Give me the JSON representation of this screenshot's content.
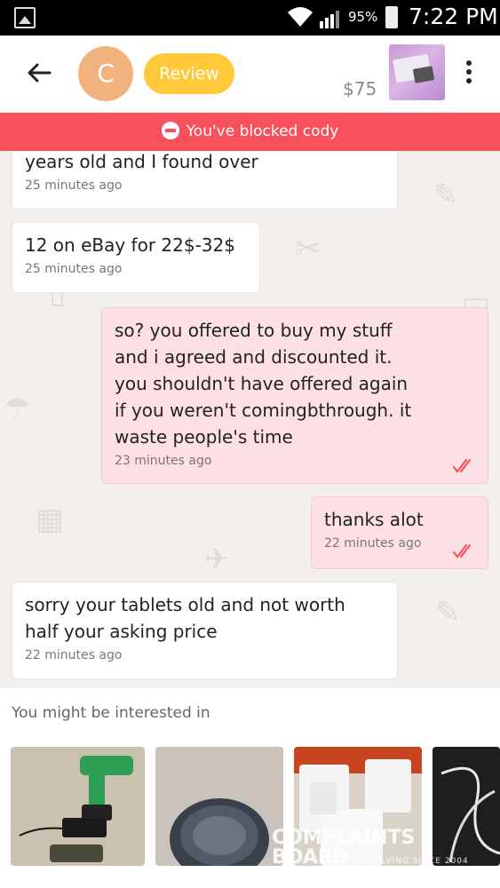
{
  "status_bar": {
    "battery": "95%",
    "time": "7:22 PM"
  },
  "header": {
    "avatar_initial": "C",
    "review_label": "Review",
    "price": "$75"
  },
  "banner": {
    "text": "You've blocked cody"
  },
  "messages": [
    {
      "direction": "in",
      "text": "years old and I found over",
      "time": "25 minutes ago"
    },
    {
      "direction": "in",
      "text": "12 on eBay for 22$-32$",
      "time": "25 minutes ago"
    },
    {
      "direction": "out",
      "text": "so? you offered to buy my stuff\nand i agreed and discounted it.\nyou shouldn't have offered again\nif you weren't comingbthrough. it\nwaste people's time",
      "time": "23 minutes ago"
    },
    {
      "direction": "out",
      "text": "thanks alot",
      "time": "22 minutes ago"
    },
    {
      "direction": "in",
      "text": "sorry your tablets old and not worth\nhalf your asking price",
      "time": "22 minutes ago"
    }
  ],
  "recommendations": {
    "title": "You might be interested in",
    "watermark": {
      "line1": "COMPLAINTS",
      "line2": "BOARD",
      "tag": "RESOLVING SINCE 2004"
    }
  },
  "colors": {
    "accent": "#f7515c",
    "review": "#ffc93a",
    "avatar": "#f2b27d",
    "check": "#f7515c"
  }
}
